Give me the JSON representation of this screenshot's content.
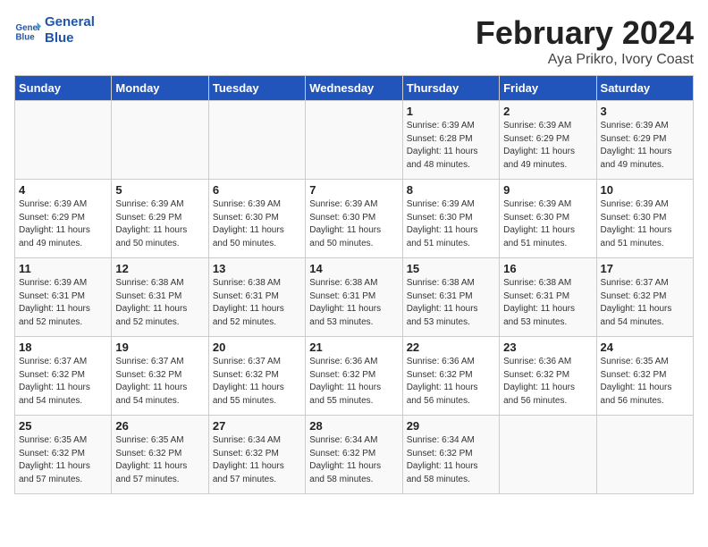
{
  "header": {
    "logo_line1": "General",
    "logo_line2": "Blue",
    "month_title": "February 2024",
    "location": "Aya Prikro, Ivory Coast"
  },
  "weekdays": [
    "Sunday",
    "Monday",
    "Tuesday",
    "Wednesday",
    "Thursday",
    "Friday",
    "Saturday"
  ],
  "weeks": [
    [
      {
        "day": "",
        "info": ""
      },
      {
        "day": "",
        "info": ""
      },
      {
        "day": "",
        "info": ""
      },
      {
        "day": "",
        "info": ""
      },
      {
        "day": "1",
        "info": "Sunrise: 6:39 AM\nSunset: 6:28 PM\nDaylight: 11 hours\nand 48 minutes."
      },
      {
        "day": "2",
        "info": "Sunrise: 6:39 AM\nSunset: 6:29 PM\nDaylight: 11 hours\nand 49 minutes."
      },
      {
        "day": "3",
        "info": "Sunrise: 6:39 AM\nSunset: 6:29 PM\nDaylight: 11 hours\nand 49 minutes."
      }
    ],
    [
      {
        "day": "4",
        "info": "Sunrise: 6:39 AM\nSunset: 6:29 PM\nDaylight: 11 hours\nand 49 minutes."
      },
      {
        "day": "5",
        "info": "Sunrise: 6:39 AM\nSunset: 6:29 PM\nDaylight: 11 hours\nand 50 minutes."
      },
      {
        "day": "6",
        "info": "Sunrise: 6:39 AM\nSunset: 6:30 PM\nDaylight: 11 hours\nand 50 minutes."
      },
      {
        "day": "7",
        "info": "Sunrise: 6:39 AM\nSunset: 6:30 PM\nDaylight: 11 hours\nand 50 minutes."
      },
      {
        "day": "8",
        "info": "Sunrise: 6:39 AM\nSunset: 6:30 PM\nDaylight: 11 hours\nand 51 minutes."
      },
      {
        "day": "9",
        "info": "Sunrise: 6:39 AM\nSunset: 6:30 PM\nDaylight: 11 hours\nand 51 minutes."
      },
      {
        "day": "10",
        "info": "Sunrise: 6:39 AM\nSunset: 6:30 PM\nDaylight: 11 hours\nand 51 minutes."
      }
    ],
    [
      {
        "day": "11",
        "info": "Sunrise: 6:39 AM\nSunset: 6:31 PM\nDaylight: 11 hours\nand 52 minutes."
      },
      {
        "day": "12",
        "info": "Sunrise: 6:38 AM\nSunset: 6:31 PM\nDaylight: 11 hours\nand 52 minutes."
      },
      {
        "day": "13",
        "info": "Sunrise: 6:38 AM\nSunset: 6:31 PM\nDaylight: 11 hours\nand 52 minutes."
      },
      {
        "day": "14",
        "info": "Sunrise: 6:38 AM\nSunset: 6:31 PM\nDaylight: 11 hours\nand 53 minutes."
      },
      {
        "day": "15",
        "info": "Sunrise: 6:38 AM\nSunset: 6:31 PM\nDaylight: 11 hours\nand 53 minutes."
      },
      {
        "day": "16",
        "info": "Sunrise: 6:38 AM\nSunset: 6:31 PM\nDaylight: 11 hours\nand 53 minutes."
      },
      {
        "day": "17",
        "info": "Sunrise: 6:37 AM\nSunset: 6:32 PM\nDaylight: 11 hours\nand 54 minutes."
      }
    ],
    [
      {
        "day": "18",
        "info": "Sunrise: 6:37 AM\nSunset: 6:32 PM\nDaylight: 11 hours\nand 54 minutes."
      },
      {
        "day": "19",
        "info": "Sunrise: 6:37 AM\nSunset: 6:32 PM\nDaylight: 11 hours\nand 54 minutes."
      },
      {
        "day": "20",
        "info": "Sunrise: 6:37 AM\nSunset: 6:32 PM\nDaylight: 11 hours\nand 55 minutes."
      },
      {
        "day": "21",
        "info": "Sunrise: 6:36 AM\nSunset: 6:32 PM\nDaylight: 11 hours\nand 55 minutes."
      },
      {
        "day": "22",
        "info": "Sunrise: 6:36 AM\nSunset: 6:32 PM\nDaylight: 11 hours\nand 56 minutes."
      },
      {
        "day": "23",
        "info": "Sunrise: 6:36 AM\nSunset: 6:32 PM\nDaylight: 11 hours\nand 56 minutes."
      },
      {
        "day": "24",
        "info": "Sunrise: 6:35 AM\nSunset: 6:32 PM\nDaylight: 11 hours\nand 56 minutes."
      }
    ],
    [
      {
        "day": "25",
        "info": "Sunrise: 6:35 AM\nSunset: 6:32 PM\nDaylight: 11 hours\nand 57 minutes."
      },
      {
        "day": "26",
        "info": "Sunrise: 6:35 AM\nSunset: 6:32 PM\nDaylight: 11 hours\nand 57 minutes."
      },
      {
        "day": "27",
        "info": "Sunrise: 6:34 AM\nSunset: 6:32 PM\nDaylight: 11 hours\nand 57 minutes."
      },
      {
        "day": "28",
        "info": "Sunrise: 6:34 AM\nSunset: 6:32 PM\nDaylight: 11 hours\nand 58 minutes."
      },
      {
        "day": "29",
        "info": "Sunrise: 6:34 AM\nSunset: 6:32 PM\nDaylight: 11 hours\nand 58 minutes."
      },
      {
        "day": "",
        "info": ""
      },
      {
        "day": "",
        "info": ""
      }
    ]
  ]
}
